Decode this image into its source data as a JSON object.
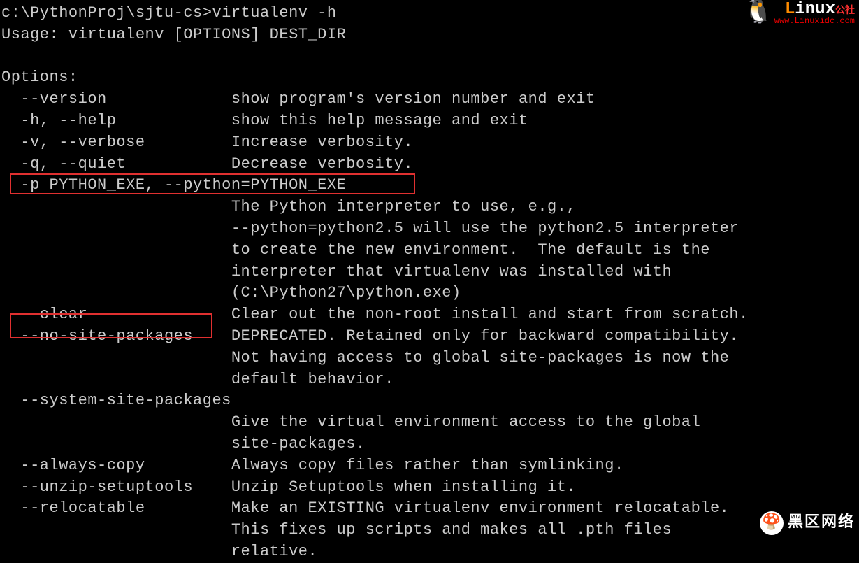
{
  "terminal": {
    "prompt": "c:\\PythonProj\\sjtu-cs>",
    "command": "virtualenv -h",
    "usage": "Usage: virtualenv [OPTIONS] DEST_DIR",
    "options_header": "Options:",
    "opts": [
      {
        "flag": "--version",
        "desc": "show program's version number and exit"
      },
      {
        "flag": "-h, --help",
        "desc": "show this help message and exit"
      },
      {
        "flag": "-v, --verbose",
        "desc": "Increase verbosity."
      },
      {
        "flag": "-q, --quiet",
        "desc": "Decrease verbosity."
      },
      {
        "flag": "-p PYTHON_EXE, --python=PYTHON_EXE",
        "desc": ""
      }
    ],
    "python_desc_l1": "The Python interpreter to use, e.g.,",
    "python_desc_l2": "--python=python2.5 will use the python2.5 interpreter",
    "python_desc_l3": "to create the new environment.  The default is the",
    "python_desc_l4": "interpreter that virtualenv was installed with",
    "python_desc_l5": "(C:\\Python27\\python.exe)",
    "clear_flag": "--clear",
    "clear_desc": "Clear out the non-root install and start from scratch.",
    "nosite_flag": "--no-site-packages",
    "nosite_desc_l1": "DEPRECATED. Retained only for backward compatibility.",
    "nosite_desc_l2": "Not having access to global site-packages is now the",
    "nosite_desc_l3": "default behavior.",
    "syspackages_flag": "--system-site-packages",
    "syspackages_desc_l1": "Give the virtual environment access to the global",
    "syspackages_desc_l2": "site-packages.",
    "always_flag": "--always-copy",
    "always_desc": "Always copy files rather than symlinking.",
    "unzip_flag": "--unzip-setuptools",
    "unzip_desc": "Unzip Setuptools when installing it.",
    "reloc_flag": "--relocatable",
    "reloc_desc_l1": "Make an EXISTING virtualenv environment relocatable.",
    "reloc_desc_l2": "This fixes up scripts and makes all .pth files",
    "reloc_desc_l3": "relative."
  },
  "watermark1": {
    "brand_l": "L",
    "brand_rest": "inux",
    "brand_cn": "公社",
    "url": "www.Linuxidc.com"
  },
  "watermark2": {
    "text": "黑区网络"
  }
}
